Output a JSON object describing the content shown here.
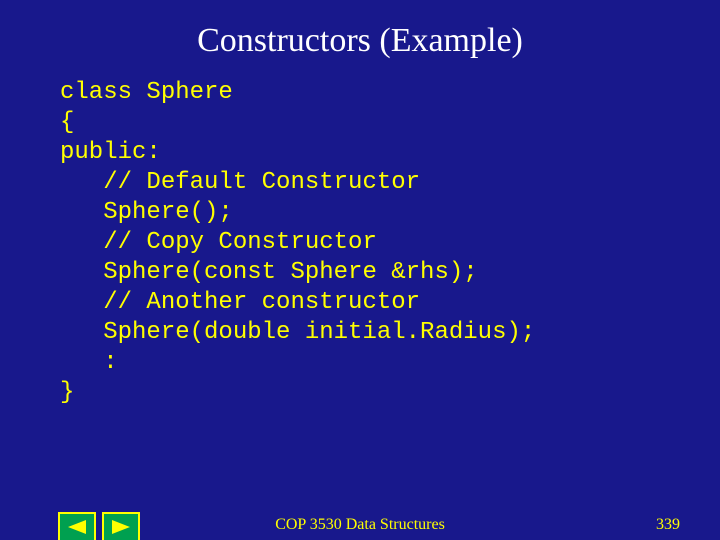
{
  "title": "Constructors (Example)",
  "code": "class Sphere\n{\npublic:\n   // Default Constructor\n   Sphere();\n   // Copy Constructor\n   Sphere(const Sphere &rhs);\n   // Another constructor\n   Sphere(double initial.Radius);\n   :\n}",
  "footer": {
    "course": "COP 3530 Data Structures",
    "page": "339"
  }
}
